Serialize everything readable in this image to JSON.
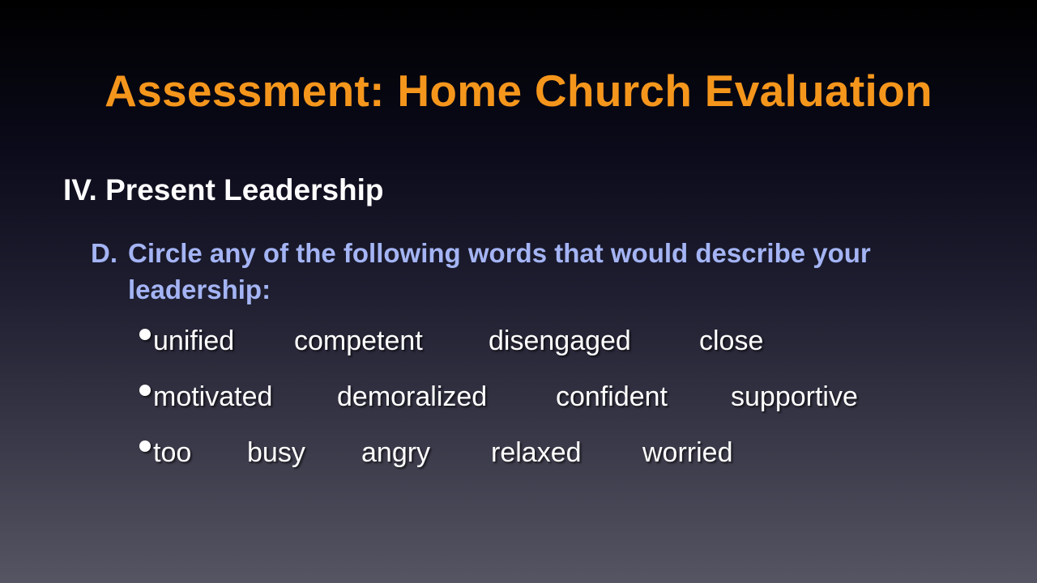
{
  "slide": {
    "title": "Assessment: Home Church Evaluation",
    "section": "IV. Present Leadership",
    "item_label": "D.",
    "item_text": "Circle any of the following words that would describe your leadership:",
    "bullet_rows": [
      [
        "unified",
        "competent",
        "disengaged",
        "close"
      ],
      [
        "motivated",
        "demoralized",
        "confident",
        "supportive"
      ],
      [
        "too",
        "busy",
        "angry",
        "relaxed",
        "worried"
      ]
    ],
    "colors": {
      "title": "#f5961c",
      "section": "#ffffff",
      "item": "#a4b4f4",
      "words": "#ffffff"
    }
  }
}
